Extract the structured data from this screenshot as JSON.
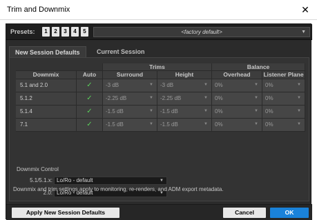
{
  "window": {
    "title": "Trim and Downmix",
    "close_glyph": "✕"
  },
  "presets": {
    "label": "Presets:",
    "buttons": [
      "1",
      "2",
      "3",
      "4",
      "5"
    ],
    "factory_value": "<factory default>",
    "dropdown_glyph": "▼"
  },
  "tabs": [
    "New Session Defaults",
    "Current Session"
  ],
  "table": {
    "group_headers": {
      "trims": "Trims",
      "balance": "Balance"
    },
    "columns": [
      "Downmix",
      "Auto",
      "Surround",
      "Height",
      "Overhead",
      "Listener Plane"
    ],
    "rows": [
      {
        "downmix": "5.1 and 2.0",
        "auto": "✓",
        "surround": "-3 dB",
        "height": "-3 dB",
        "overhead": "0%",
        "listener": "0%"
      },
      {
        "downmix": "5.1.2",
        "auto": "✓",
        "surround": "-2.25 dB",
        "height": "-2.25 dB",
        "overhead": "0%",
        "listener": "0%"
      },
      {
        "downmix": "5.1.4",
        "auto": "✓",
        "surround": "-1.5 dB",
        "height": "-1.5 dB",
        "overhead": "0%",
        "listener": "0%"
      },
      {
        "downmix": "7.1",
        "auto": "✓",
        "surround": "-1.5 dB",
        "height": "-1.5 dB",
        "overhead": "0%",
        "listener": "0%"
      }
    ],
    "dropdown_glyph": "▼"
  },
  "downmix_control": {
    "title": "Downmix Control",
    "rows": [
      {
        "label": "5.1/5.1.x:",
        "value": "Lo/Ro - default"
      },
      {
        "label": "2.0:",
        "value": "Lo/Ro - default"
      }
    ]
  },
  "note": "Downmix and trim settings apply to monitoring, re-renders, and ADM export metadata.",
  "footer": {
    "apply_label": "Apply New Session Defaults",
    "cancel_label": "Cancel",
    "ok_label": "OK"
  },
  "colors": {
    "ok_blue": "#1a82d9",
    "check_green": "#5bd25b",
    "panel": "#333333"
  }
}
